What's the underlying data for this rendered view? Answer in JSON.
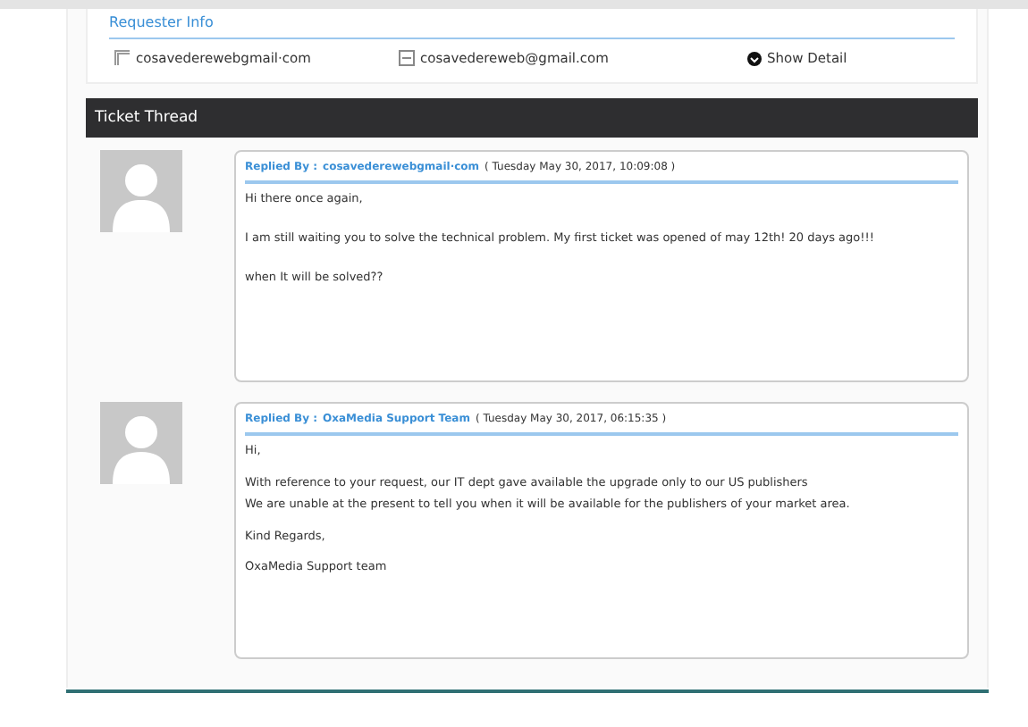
{
  "requester_info": {
    "title": "Requester Info",
    "name": "cosavederewebgmail·com",
    "email": "cosavedereweb@gmail.com",
    "show_detail": "Show Detail"
  },
  "ticket_thread": {
    "title": "Ticket Thread",
    "messages": [
      {
        "label": "Replied By :",
        "author": "cosavederewebgmail·com",
        "date": "( Tuesday May 30, 2017, 10:09:08 )",
        "paragraphs": [
          [
            "Hi there once again,"
          ],
          [
            "I am still waiting you to solve the technical problem. My first ticket was opened of may 12th! 20 days ago!!!"
          ],
          [
            "when It will be solved??"
          ]
        ]
      },
      {
        "label": "Replied By :",
        "author": "OxaMedia Support Team",
        "date": "( Tuesday May 30, 2017, 06:15:35 )",
        "paragraphs": [
          [
            "Hi,"
          ],
          [
            "With reference to your request, our IT dept gave available the upgrade only to our US publishers",
            "We are unable at the present to tell you when it will be available for the publishers of your market area."
          ],
          [
            "Kind Regards,"
          ],
          [
            "OxaMedia Support team"
          ]
        ]
      }
    ]
  }
}
